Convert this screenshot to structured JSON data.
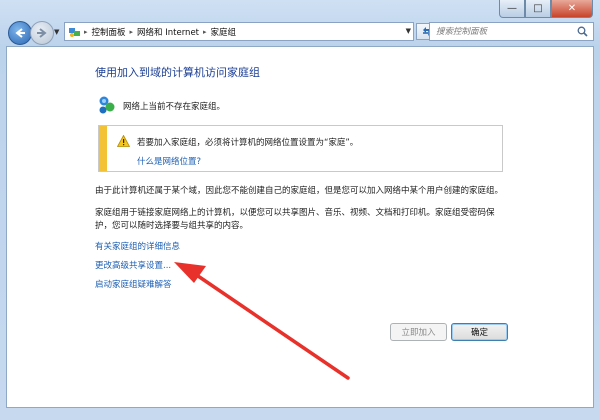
{
  "window": {
    "caption_buttons": {
      "minimize": "—",
      "maximize": "□",
      "close": "✕"
    }
  },
  "toolbar": {
    "breadcrumb": [
      "控制面板",
      "网络和 Internet",
      "家庭组"
    ],
    "search_placeholder": "搜索控制面板",
    "icons": {
      "back": "back-arrow-icon",
      "forward": "forward-arrow-icon",
      "refresh": "refresh-icon",
      "search": "search-icon",
      "location": "control-panel-icon"
    }
  },
  "content": {
    "heading": "使用加入到域的计算机访问家庭组",
    "status": "网络上当前不存在家庭组。",
    "notice": {
      "message": "若要加入家庭组，必须将计算机的网络位置设置为“家庭”。",
      "link": "什么是网络位置?"
    },
    "para1": "由于此计算机还属于某个域，因此您不能创建自己的家庭组，但是您可以加入网络中某个用户创建的家庭组。",
    "para2": "家庭组用于链接家庭网络上的计算机，以便您可以共享图片、音乐、视频、文档和打印机。家庭组受密码保护，您可以随时选择要与组共享的内容。",
    "links": [
      "有关家庭组的详细信息",
      "更改高级共享设置...",
      "启动家庭组疑难解答"
    ],
    "buttons": {
      "join": "立即加入",
      "ok": "确定"
    },
    "annotation_color": "#e8312a"
  }
}
